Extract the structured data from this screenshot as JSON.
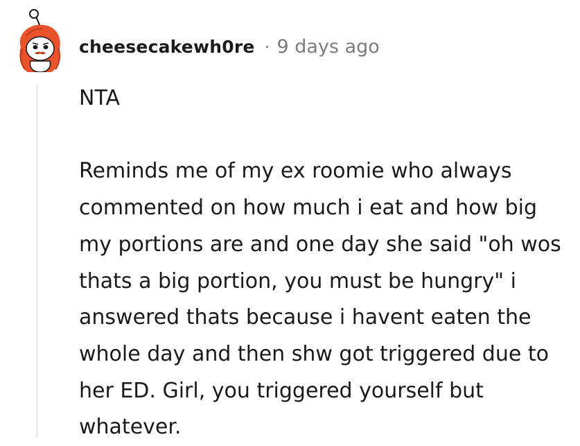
{
  "comment": {
    "author": "cheesecakewh0re",
    "separator": "·",
    "timestamp": "9 days ago",
    "avatar_icon": "snoo-avatar-icon",
    "paragraphs": [
      "NTA",
      "Reminds me of my ex roomie who always commented on how much i eat and how big my portions are and one day she said \"oh wos thats a big portion, you must be hungry\" i answered thats because i havent eaten the whole day and then shw got triggered due to her ED. Girl, you triggered yourself but whatever."
    ]
  },
  "colors": {
    "hair": "#e8532b",
    "text": "#1a1a1b",
    "meta": "#7c7c7c",
    "thread_line": "#edeff1"
  }
}
